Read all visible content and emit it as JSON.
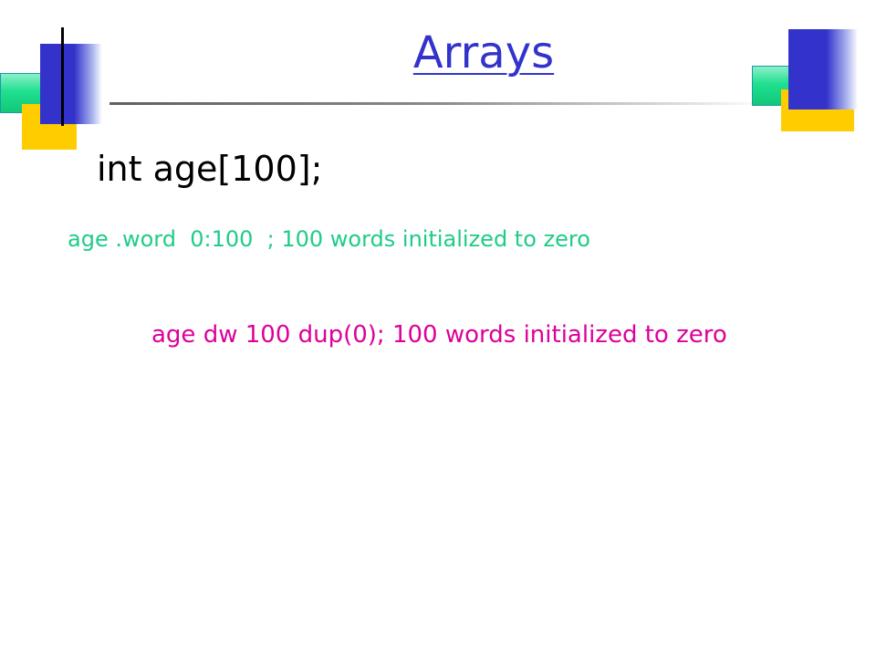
{
  "slide": {
    "title": "Arrays",
    "declaration": "int age[100];",
    "code_line_1": "age .word  0:100  ; 100 words initialized to zero",
    "code_line_2": "age dw 100 dup(0); 100 words initialized to zero"
  },
  "colors": {
    "title": "#3333cc",
    "declaration": "#000000",
    "code_line_1": "#1ecc88",
    "code_line_2": "#dd0099",
    "accent_blue": "#3333cc",
    "accent_yellow": "#ffcc00",
    "accent_green": "#20e090"
  }
}
